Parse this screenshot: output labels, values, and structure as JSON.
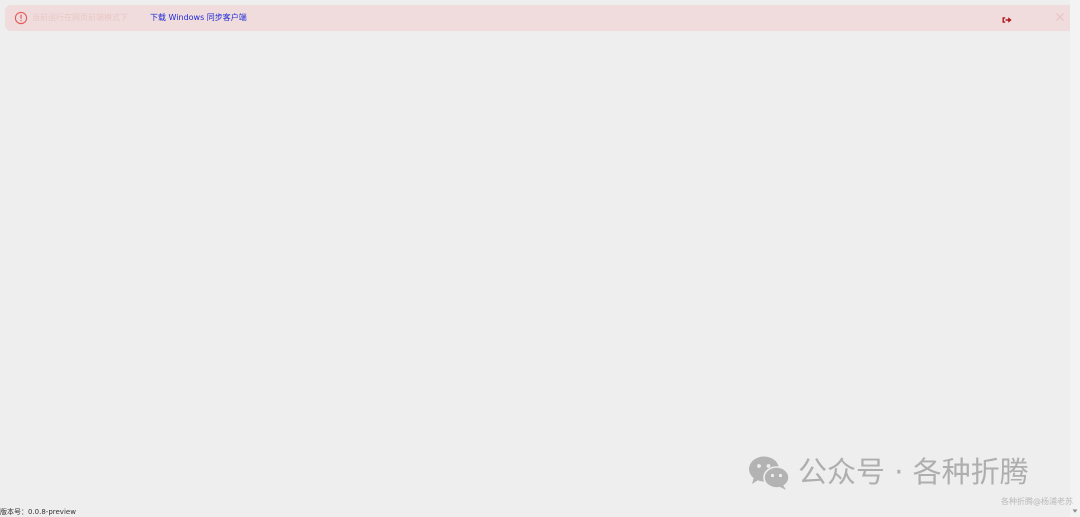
{
  "alert": {
    "message": "当前运行在网页前端模式下",
    "link_label": "下载 Windows 同步客户端",
    "icon": "alert-circle-icon",
    "close_icon": "close-icon",
    "logout_icon": "logout-icon",
    "colors": {
      "background": "#f0dcdc",
      "icon": "#e25a5a",
      "link": "#1f2bd6",
      "logout": "#b0171b"
    }
  },
  "watermark": {
    "text": "公众号 · 各种折腾",
    "caption": "各种折腾@杨浦老苏",
    "icon": "wechat-icon"
  },
  "footer": {
    "version": "版本号：0.0.8-preview"
  },
  "colors": {
    "page_background": "#eeeeee"
  }
}
